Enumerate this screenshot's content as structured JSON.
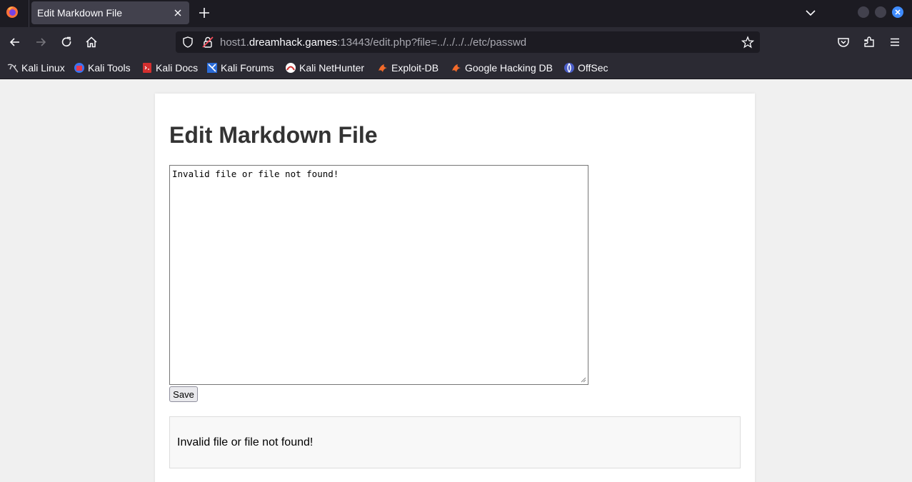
{
  "browser": {
    "tab": {
      "title": "Edit Markdown File"
    },
    "url": {
      "host_prefix": "host1.",
      "host_domain": "dreamhack.games",
      "rest": ":13443/edit.php?file=../../../../etc/passwd"
    },
    "bookmarks": [
      {
        "label": "Kali Linux",
        "icon": "kali-dragon-icon"
      },
      {
        "label": "Kali Tools",
        "icon": "kali-tools-icon"
      },
      {
        "label": "Kali Docs",
        "icon": "kali-docs-icon"
      },
      {
        "label": "Kali Forums",
        "icon": "kali-forums-icon"
      },
      {
        "label": "Kali NetHunter",
        "icon": "kali-nethunter-icon"
      },
      {
        "label": "Exploit-DB",
        "icon": "exploit-db-icon"
      },
      {
        "label": "Google Hacking DB",
        "icon": "ghdb-icon"
      },
      {
        "label": "OffSec",
        "icon": "offsec-icon"
      }
    ],
    "colors": {
      "accent": "#3f8cff",
      "tabbar": "#1c1b22",
      "toolbar": "#2b2a33"
    }
  },
  "page": {
    "title": "Edit Markdown File",
    "editor_value": "Invalid file or file not found!",
    "save_label": "Save",
    "preview_text": "Invalid file or file not found!"
  }
}
